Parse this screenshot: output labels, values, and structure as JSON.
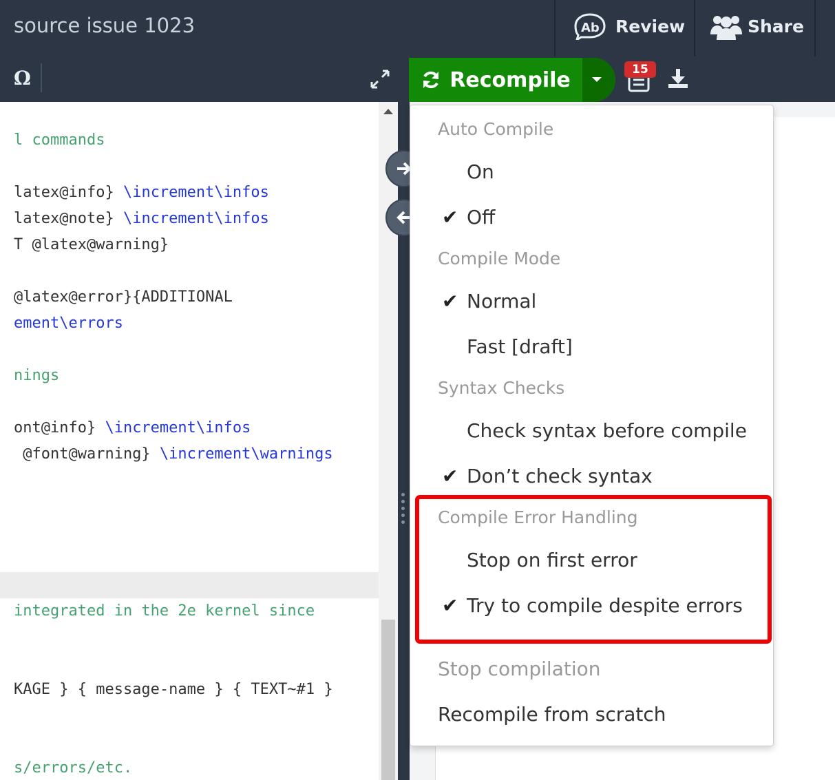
{
  "topbar": {
    "project_title": "source issue 1023",
    "review_label": "Review",
    "share_label": "Share"
  },
  "toolbar": {
    "omega_symbol": "Ω",
    "recompile_label": "Recompile",
    "log_count": "15"
  },
  "editor": {
    "lines": [
      {
        "a": "l commands",
        "b": ""
      },
      {
        "a": "latex@info} ",
        "b": "\\increment\\infos"
      },
      {
        "a": "latex@note} ",
        "b": "\\increment\\infos"
      },
      {
        "a": "T @latex@warning}",
        "b": ""
      },
      {
        "a": "@latex@error}{ADDITIONAL",
        "b": ""
      },
      {
        "a": "",
        "b": "ement\\errors"
      },
      {
        "a": "nings",
        "b": ""
      },
      {
        "a": "ont@info} ",
        "b": "\\increment\\infos"
      },
      {
        "a": " @font@warning} ",
        "b": "\\increment\\warnings"
      },
      {
        "a": "integrated in the 2e kernel since",
        "b": ""
      },
      {
        "a": "KAGE } { message-name } { TEXT~#1 }",
        "b": ""
      },
      {
        "a": "s/errors/etc.",
        "b": ""
      }
    ]
  },
  "menu": {
    "auto_compile_header": "Auto Compile",
    "auto_on": "On",
    "auto_off": "Off",
    "compile_mode_header": "Compile Mode",
    "mode_normal": "Normal",
    "mode_fast": "Fast [draft]",
    "syntax_header": "Syntax Checks",
    "syntax_check": "Check syntax before compile",
    "syntax_dont": "Don’t check syntax",
    "error_header": "Compile Error Handling",
    "error_stop": "Stop on first error",
    "error_try": "Try to compile despite errors",
    "stop_compilation": "Stop compilation",
    "recompile_scratch": "Recompile from scratch",
    "check_glyph": "✔"
  },
  "colors": {
    "recompile_green": "#138a07",
    "highlight_red": "#f00000",
    "badge_red": "#d22c2c"
  }
}
